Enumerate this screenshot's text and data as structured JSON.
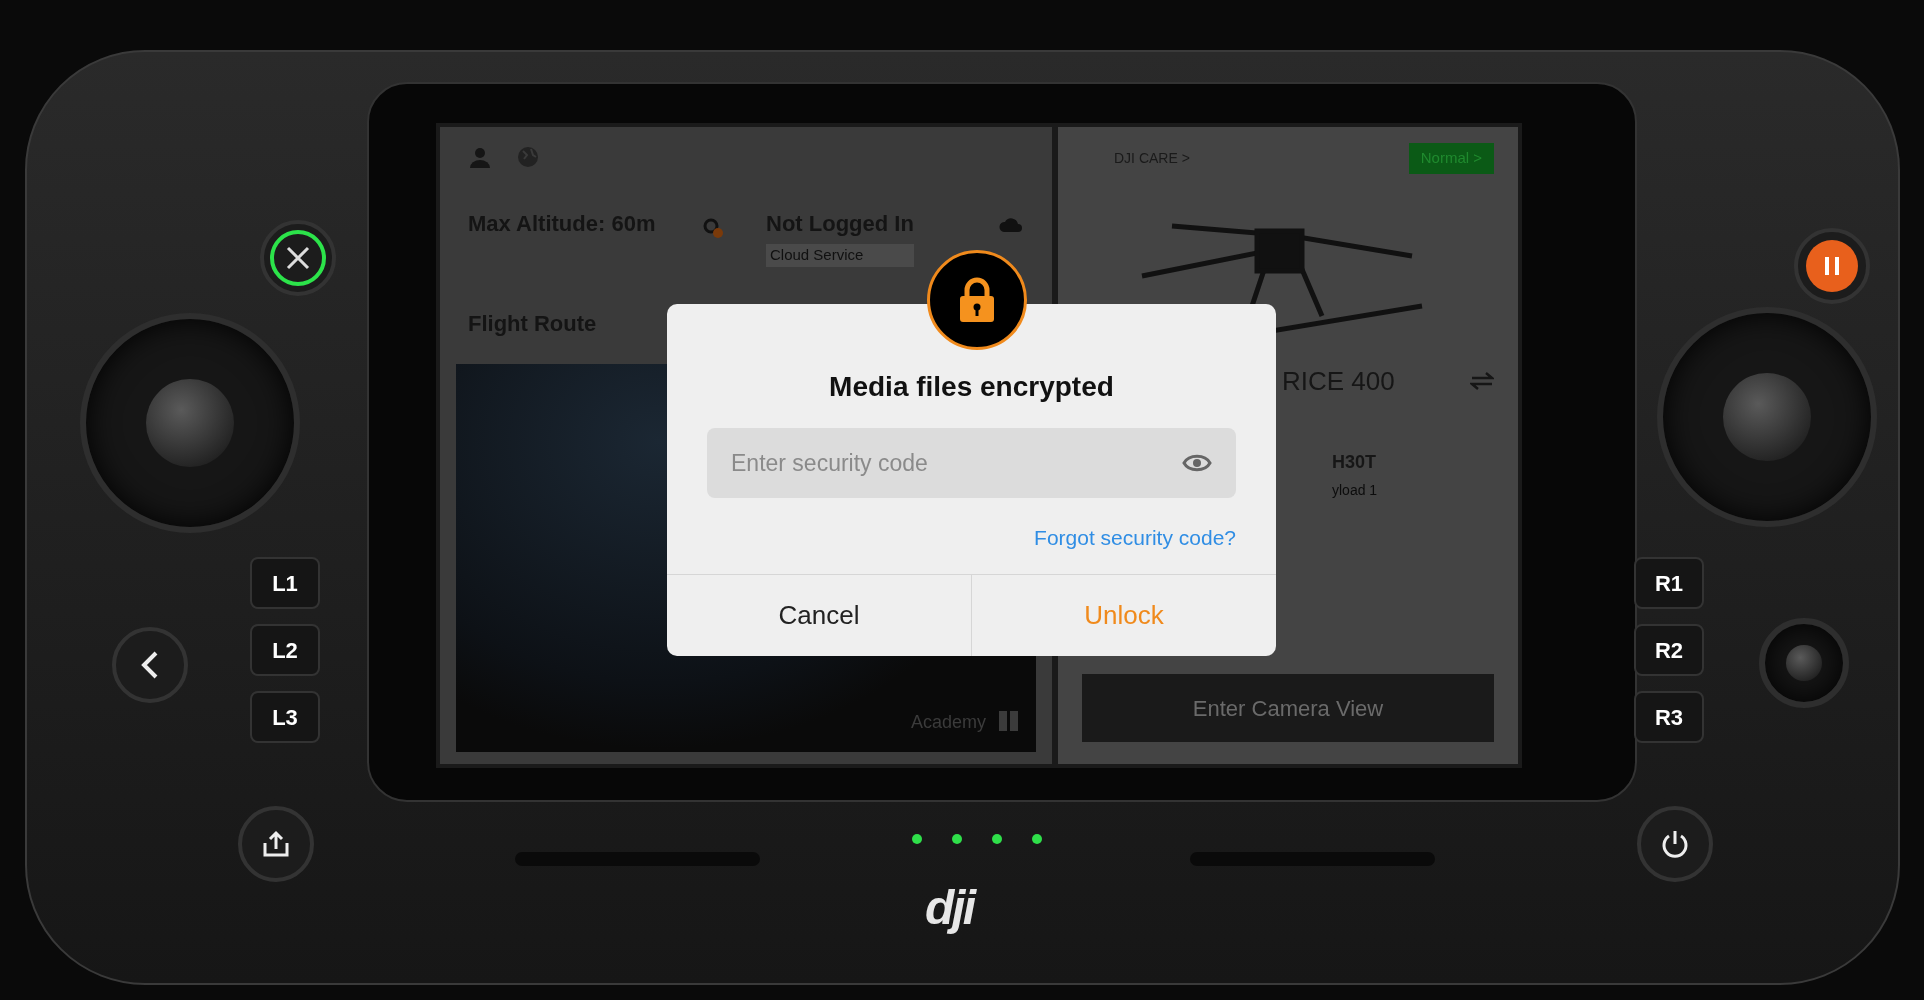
{
  "screen": {
    "status_cards": [
      {
        "title": "Max Altitude: 60m",
        "kind": "altitude"
      },
      {
        "title": "Not Logged In",
        "subtitle": "Cloud Service",
        "kind": "cloud"
      }
    ],
    "flight_route": {
      "title": "Flight Route",
      "academy": "Academy"
    },
    "care": {
      "label": "DJI CARE >"
    },
    "status_badge": {
      "label": "Normal >"
    },
    "aircraft": {
      "name": "RICE 400"
    },
    "payload": {
      "name": "H30T",
      "subtitle": "yload 1"
    },
    "camera_button": {
      "label": "Enter Camera View"
    }
  },
  "dialog": {
    "title": "Media files encrypted",
    "input": {
      "placeholder": "Enter security code"
    },
    "link": "Forgot security code?",
    "buttons": [
      {
        "label": "Cancel",
        "kind": "cancel"
      },
      {
        "label": "Unlock",
        "kind": "confirm"
      }
    ]
  },
  "controller": {
    "left_buttons": [
      "L1",
      "L2",
      "L3"
    ],
    "right_buttons": [
      "R1",
      "R2",
      "R3"
    ],
    "logo": "dji",
    "leds": [
      {
        "on": true
      },
      {
        "on": true
      },
      {
        "on": true
      },
      {
        "on": true
      }
    ]
  }
}
